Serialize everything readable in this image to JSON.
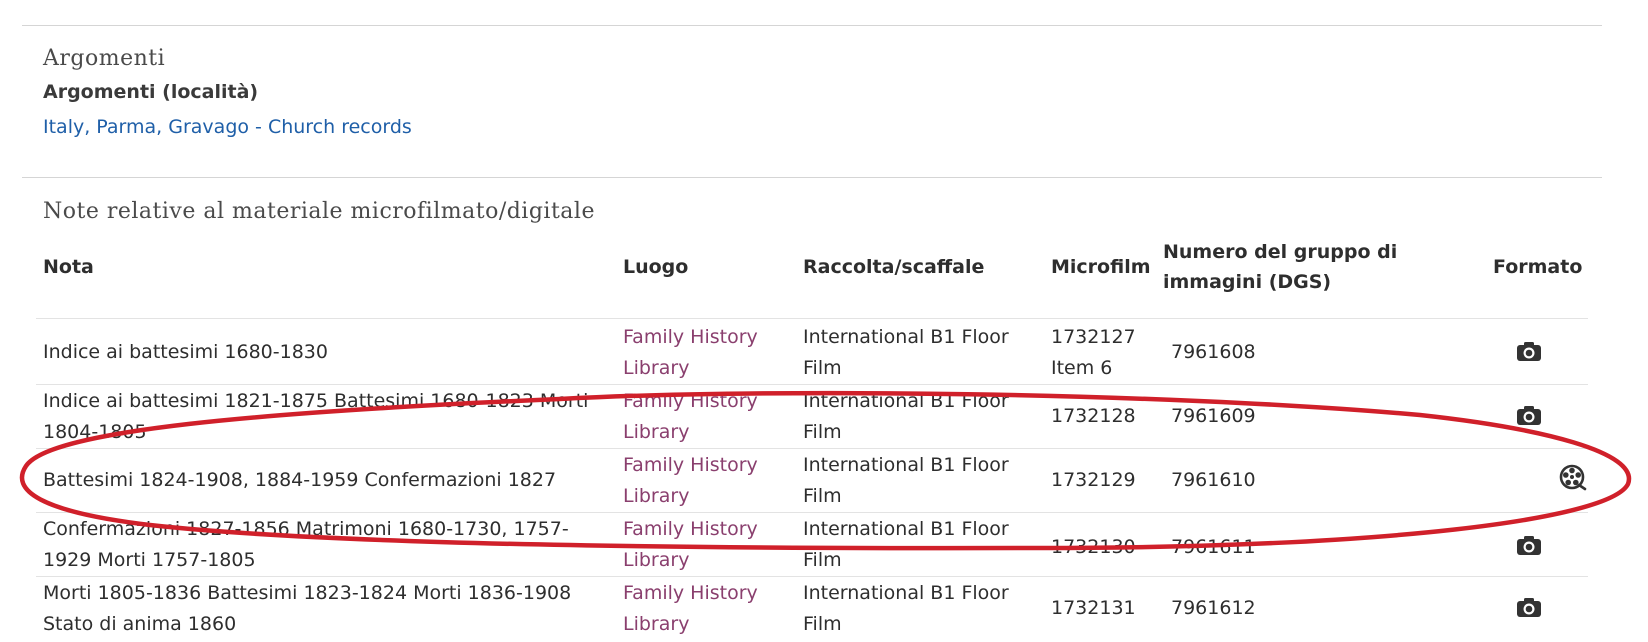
{
  "argomenti": {
    "heading": "Argomenti",
    "subheading": "Argomenti (località)",
    "link": "Italy, Parma, Gravago - Church records"
  },
  "notes": {
    "heading": "Note relative al materiale microfilmato/digitale",
    "columns": {
      "nota": "Nota",
      "luogo": "Luogo",
      "raccolta": "Raccolta/scaffale",
      "microfilm": "Microfilm",
      "dgs_line1": "Numero del gruppo di",
      "dgs_line2": "immagini (DGS)",
      "formato": "Formato"
    },
    "rows": [
      {
        "nota_l1": "Indice ai battesimi 1680-1830",
        "nota_l2": "",
        "luogo_l1": "Family History",
        "luogo_l2": "Library",
        "raccolta_l1": "International B1 Floor",
        "raccolta_l2": "Film",
        "microfilm_l1": "1732127",
        "microfilm_l2": "Item 6",
        "dgs": "7961608",
        "format_icon": "camera-icon"
      },
      {
        "nota_l1": "Indice ai battesimi 1821-1875 Battesimi 1680-1823 Morti",
        "nota_l2": "1804-1805",
        "luogo_l1": "Family History",
        "luogo_l2": "Library",
        "raccolta_l1": "International B1 Floor",
        "raccolta_l2": "Film",
        "microfilm_l1": "1732128",
        "microfilm_l2": "",
        "dgs": "7961609",
        "format_icon": "camera-icon"
      },
      {
        "nota_l1": "Battesimi 1824-1908, 1884-1959 Confermazioni 1827",
        "nota_l2": "",
        "luogo_l1": "Family History",
        "luogo_l2": "Library",
        "raccolta_l1": "International B1 Floor",
        "raccolta_l2": "Film",
        "microfilm_l1": "1732129",
        "microfilm_l2": "",
        "dgs": "7961610",
        "format_icon": "film-reel-icon"
      },
      {
        "nota_l1": "Confermazioni 1827-1856 Matrimoni 1680-1730, 1757-",
        "nota_l2": "1929 Morti 1757-1805",
        "luogo_l1": "Family History",
        "luogo_l2": "Library",
        "raccolta_l1": "International B1 Floor",
        "raccolta_l2": "Film",
        "microfilm_l1": "1732130",
        "microfilm_l2": "",
        "dgs": "7961611",
        "format_icon": "camera-icon"
      },
      {
        "nota_l1": "Morti 1805-1836 Battesimi 1823-1824 Morti 1836-1908",
        "nota_l2": "Stato di anima 1860",
        "luogo_l1": "Family History",
        "luogo_l2": "Library",
        "raccolta_l1": "International B1 Floor",
        "raccolta_l2": "Film",
        "microfilm_l1": "1732131",
        "microfilm_l2": "",
        "dgs": "7961612",
        "format_icon": "camera-icon"
      }
    ]
  },
  "colors": {
    "link_blue": "#1f5fa8",
    "location_link": "#8a3f6e",
    "annotation_red": "#d0202a",
    "icon_dark": "#333333"
  }
}
